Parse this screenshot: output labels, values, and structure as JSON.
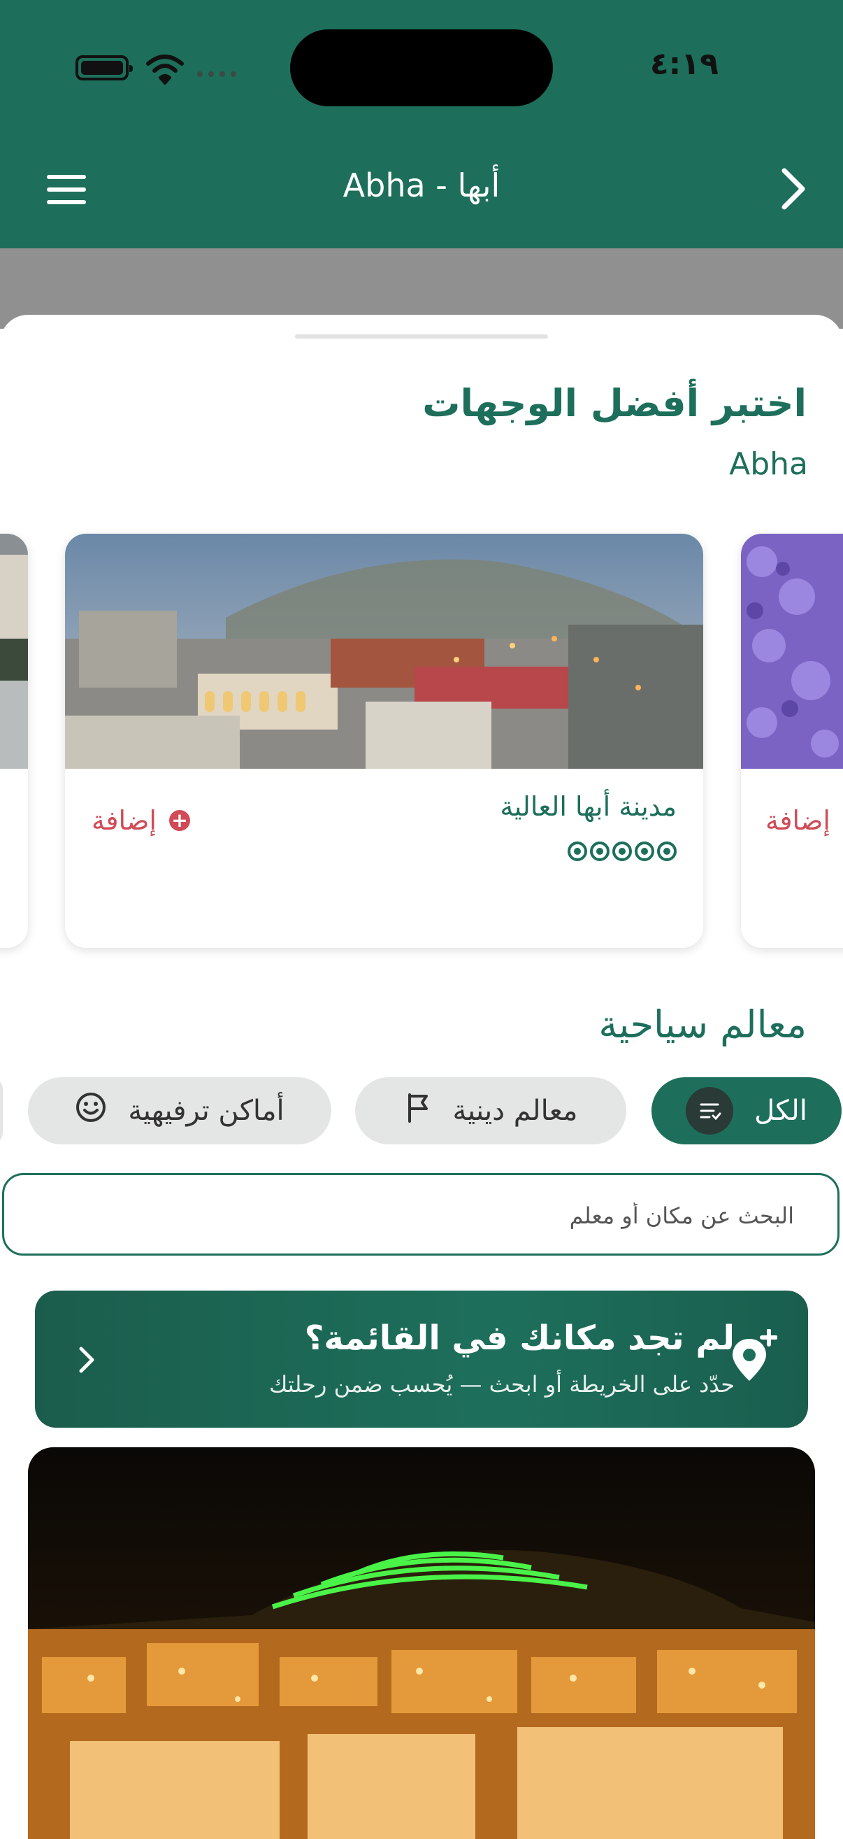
{
  "status_bar": {
    "time": "٤:١٩"
  },
  "header": {
    "title": "Abha - أبها"
  },
  "destinations": {
    "title": "اختبر أفضل الوجهات",
    "subtitle": "Abha",
    "cards": [
      {
        "name": "مدينة أبها العالية",
        "add_label": "إضافة",
        "rating": 5
      }
    ],
    "peek_add_label": "إضافة"
  },
  "attractions": {
    "title": "معالم سياحية",
    "filters": [
      {
        "label": "الكل",
        "icon": "list-filter-icon",
        "selected": true
      },
      {
        "label": "معالم دينية",
        "icon": "flag-icon",
        "selected": false
      },
      {
        "label": "أماكن ترفيهية",
        "icon": "smiley-icon",
        "selected": false
      }
    ],
    "search": {
      "placeholder": "البحث عن مكان أو معلم"
    }
  },
  "banner": {
    "title": "لم تجد مكانك في القائمة؟",
    "subtitle": "حدّد على الخريطة أو ابحث — يُحسب ضمن رحلتك",
    "icon": "add-location-icon"
  },
  "colors": {
    "primary": "#1d6f5b",
    "accent": "#d04b57",
    "chip_bg": "#e4e6e5"
  }
}
